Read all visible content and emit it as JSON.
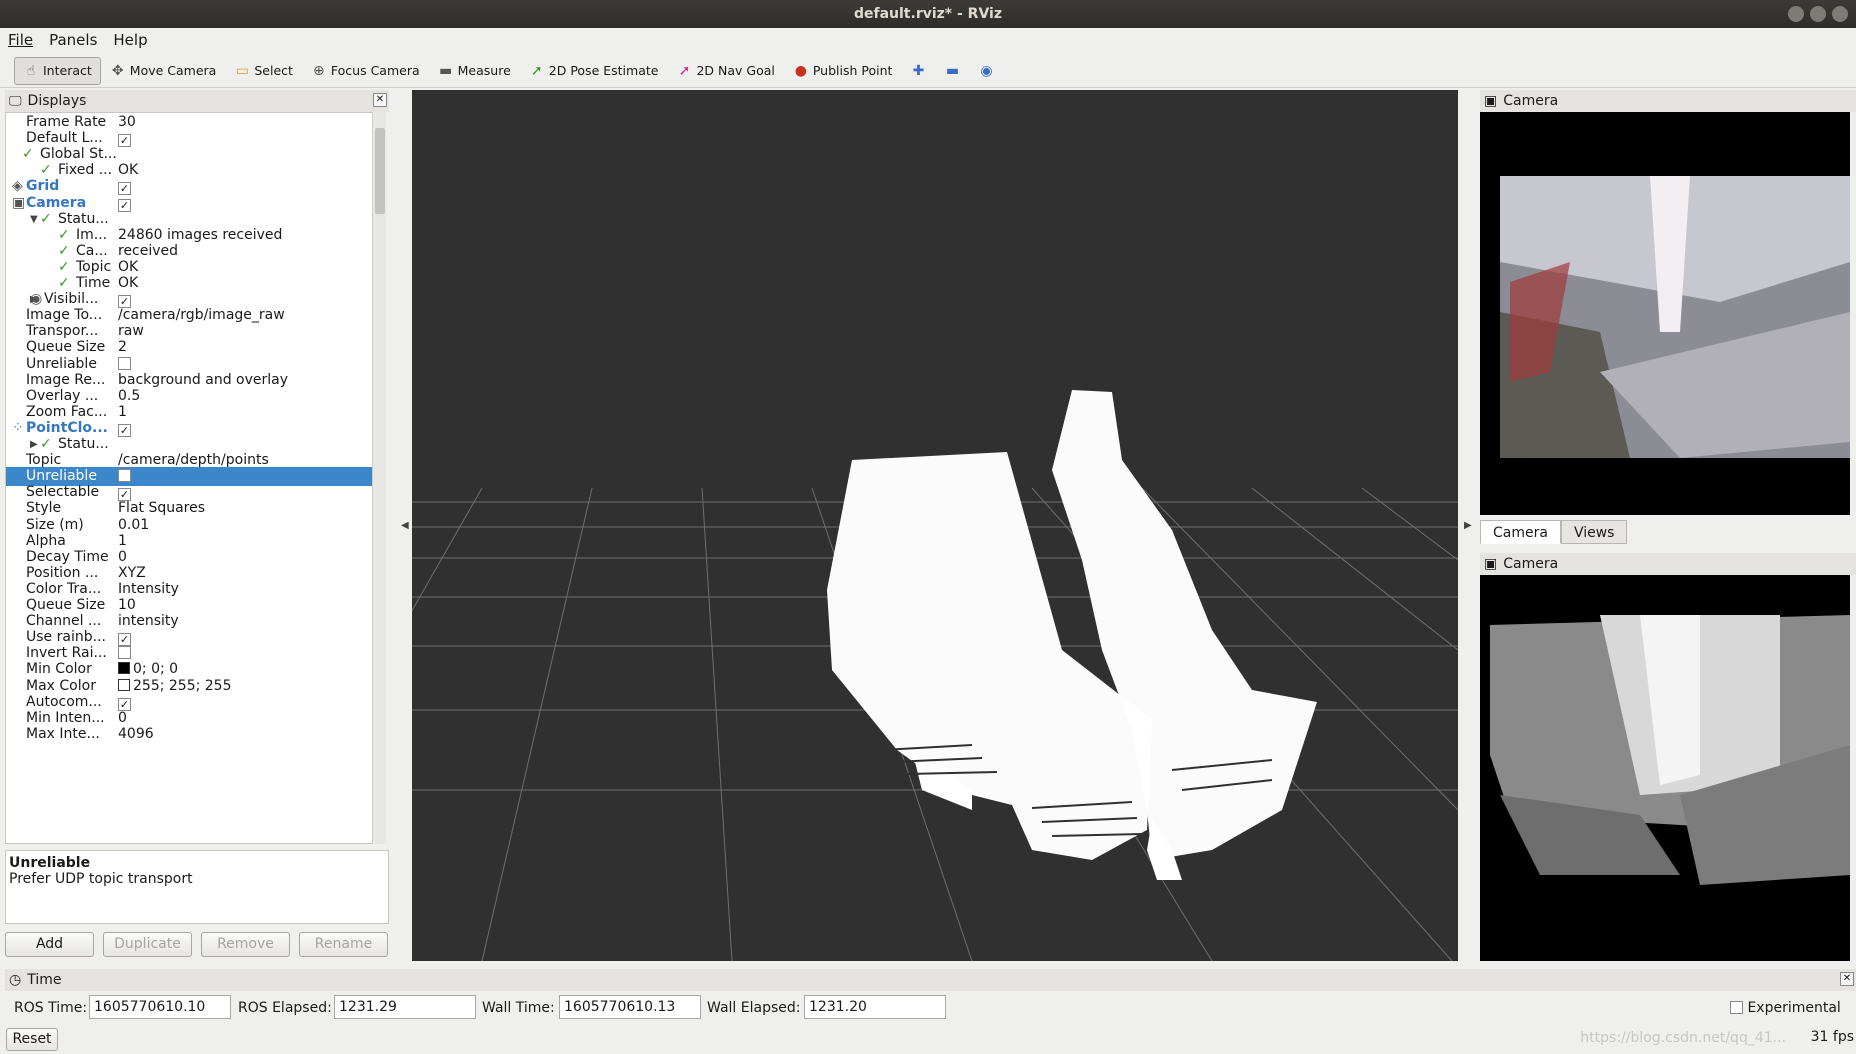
{
  "window": {
    "title": "default.rviz* - RViz"
  },
  "menu": [
    "File",
    "Panels",
    "Help"
  ],
  "toolbar": {
    "tools": [
      {
        "label": "Interact",
        "icon": "hand-icon"
      },
      {
        "label": "Move Camera",
        "icon": "move-camera-icon"
      },
      {
        "label": "Select",
        "icon": "select-icon"
      },
      {
        "label": "Focus Camera",
        "icon": "focus-camera-icon"
      },
      {
        "label": "Measure",
        "icon": "ruler-icon"
      },
      {
        "label": "2D Pose Estimate",
        "icon": "green-arrow-icon"
      },
      {
        "label": "2D Nav Goal",
        "icon": "pink-arrow-icon"
      },
      {
        "label": "Publish Point",
        "icon": "map-pin-icon"
      }
    ]
  },
  "displays": {
    "title": "Displays",
    "rows": [
      {
        "k": "Frame Rate",
        "v": "30"
      },
      {
        "k": "Default L...",
        "v": ""
      },
      {
        "k": "Global St...",
        "v": ""
      },
      {
        "k": "Fixed ...",
        "v": "OK"
      },
      {
        "k": "Grid",
        "v": ""
      },
      {
        "k": "Camera",
        "v": ""
      },
      {
        "k": "Statu...",
        "v": ""
      },
      {
        "k": "Im...",
        "v": "24860 images received"
      },
      {
        "k": "Ca...",
        "v": "received"
      },
      {
        "k": "Topic",
        "v": "OK"
      },
      {
        "k": "Time",
        "v": "OK"
      },
      {
        "k": "Visibil...",
        "v": ""
      },
      {
        "k": "Image To...",
        "v": "/camera/rgb/image_raw"
      },
      {
        "k": "Transpor...",
        "v": "raw"
      },
      {
        "k": "Queue Size",
        "v": "2"
      },
      {
        "k": "Unreliable",
        "v": ""
      },
      {
        "k": "Image Re...",
        "v": "background and overlay"
      },
      {
        "k": "Overlay ...",
        "v": "0.5"
      },
      {
        "k": "Zoom Fac...",
        "v": "1"
      },
      {
        "k": "PointClo...",
        "v": ""
      },
      {
        "k": "Statu...",
        "v": ""
      },
      {
        "k": "Topic",
        "v": "/camera/depth/points"
      },
      {
        "k": "Unreliable",
        "v": ""
      },
      {
        "k": "Selectable",
        "v": ""
      },
      {
        "k": "Style",
        "v": "Flat Squares"
      },
      {
        "k": "Size (m)",
        "v": "0.01"
      },
      {
        "k": "Alpha",
        "v": "1"
      },
      {
        "k": "Decay Time",
        "v": "0"
      },
      {
        "k": "Position ...",
        "v": "XYZ"
      },
      {
        "k": "Color Tra...",
        "v": "Intensity"
      },
      {
        "k": "Queue Size",
        "v": "10"
      },
      {
        "k": "Channel ...",
        "v": "intensity"
      },
      {
        "k": "Use rainb...",
        "v": ""
      },
      {
        "k": "Invert Rai...",
        "v": ""
      },
      {
        "k": "Min Color",
        "v": "0; 0; 0"
      },
      {
        "k": "Max Color",
        "v": "255; 255; 255"
      },
      {
        "k": "Autocom...",
        "v": ""
      },
      {
        "k": "Min Inten...",
        "v": "0"
      },
      {
        "k": "Max Inte...",
        "v": "4096"
      }
    ],
    "description_title": "Unreliable",
    "description_text": "Prefer UDP topic transport",
    "buttons": {
      "add": "Add",
      "duplicate": "Duplicate",
      "remove": "Remove",
      "rename": "Rename"
    }
  },
  "camera_panels": {
    "title": "Camera",
    "tabs": [
      "Camera",
      "Views"
    ]
  },
  "time_panel": {
    "title": "Time",
    "ros_time_label": "ROS Time:",
    "ros_time": "1605770610.10",
    "ros_elapsed_label": "ROS Elapsed:",
    "ros_elapsed": "1231.29",
    "wall_time_label": "Wall Time:",
    "wall_time": "1605770610.13",
    "wall_elapsed_label": "Wall Elapsed:",
    "wall_elapsed": "1231.20",
    "experimental_label": "Experimental",
    "reset_label": "Reset",
    "fps": "31 fps"
  },
  "watermark": "https://blog.csdn.net/qq_41..."
}
